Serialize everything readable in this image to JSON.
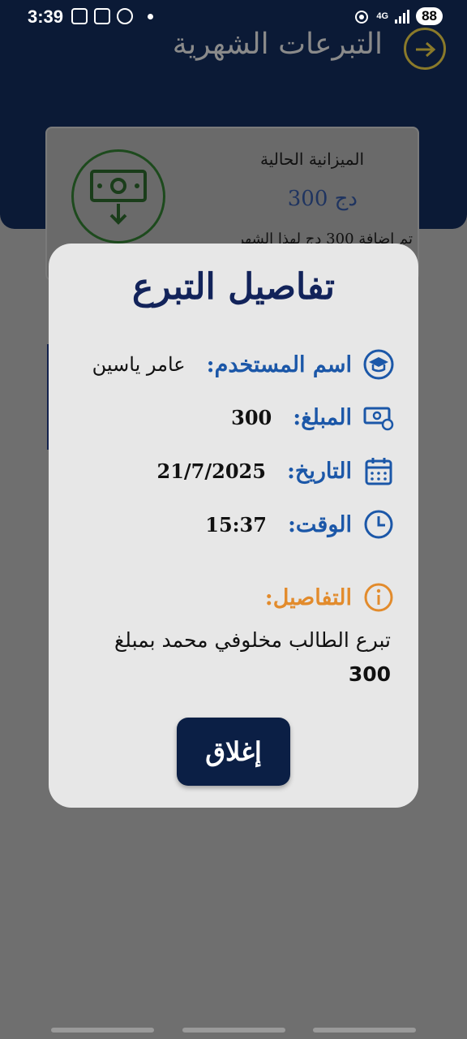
{
  "status_bar": {
    "time": "3:39",
    "network": "4G",
    "battery": "88"
  },
  "header": {
    "title": "التبرعات الشهرية"
  },
  "budget_card": {
    "label": "الميزانية الحالية",
    "value": "300 دج",
    "note": "تم إضافة 300 دج لهذا الشهر"
  },
  "dialog": {
    "title": "تفاصيل التبرع",
    "username_label": "اسم المستخدم:",
    "username_value": "عامر ياسين",
    "amount_label": "المبلغ:",
    "amount_value": "300",
    "date_label": "التاريخ:",
    "date_value": "21/7/2025",
    "time_label": "الوقت:",
    "time_value": "15:37",
    "details_label": "التفاصيل:",
    "details_text": "تبرع الطالب مخلوفي محمد بمبلغ",
    "details_amount": "300",
    "close_label": "إغلاق"
  },
  "colors": {
    "header_bg": "#0b1a36",
    "title_blue": "#12235a",
    "label_blue": "#1b57a8",
    "details_orange": "#e28b2c",
    "close_button_bg": "#0b1f45"
  }
}
